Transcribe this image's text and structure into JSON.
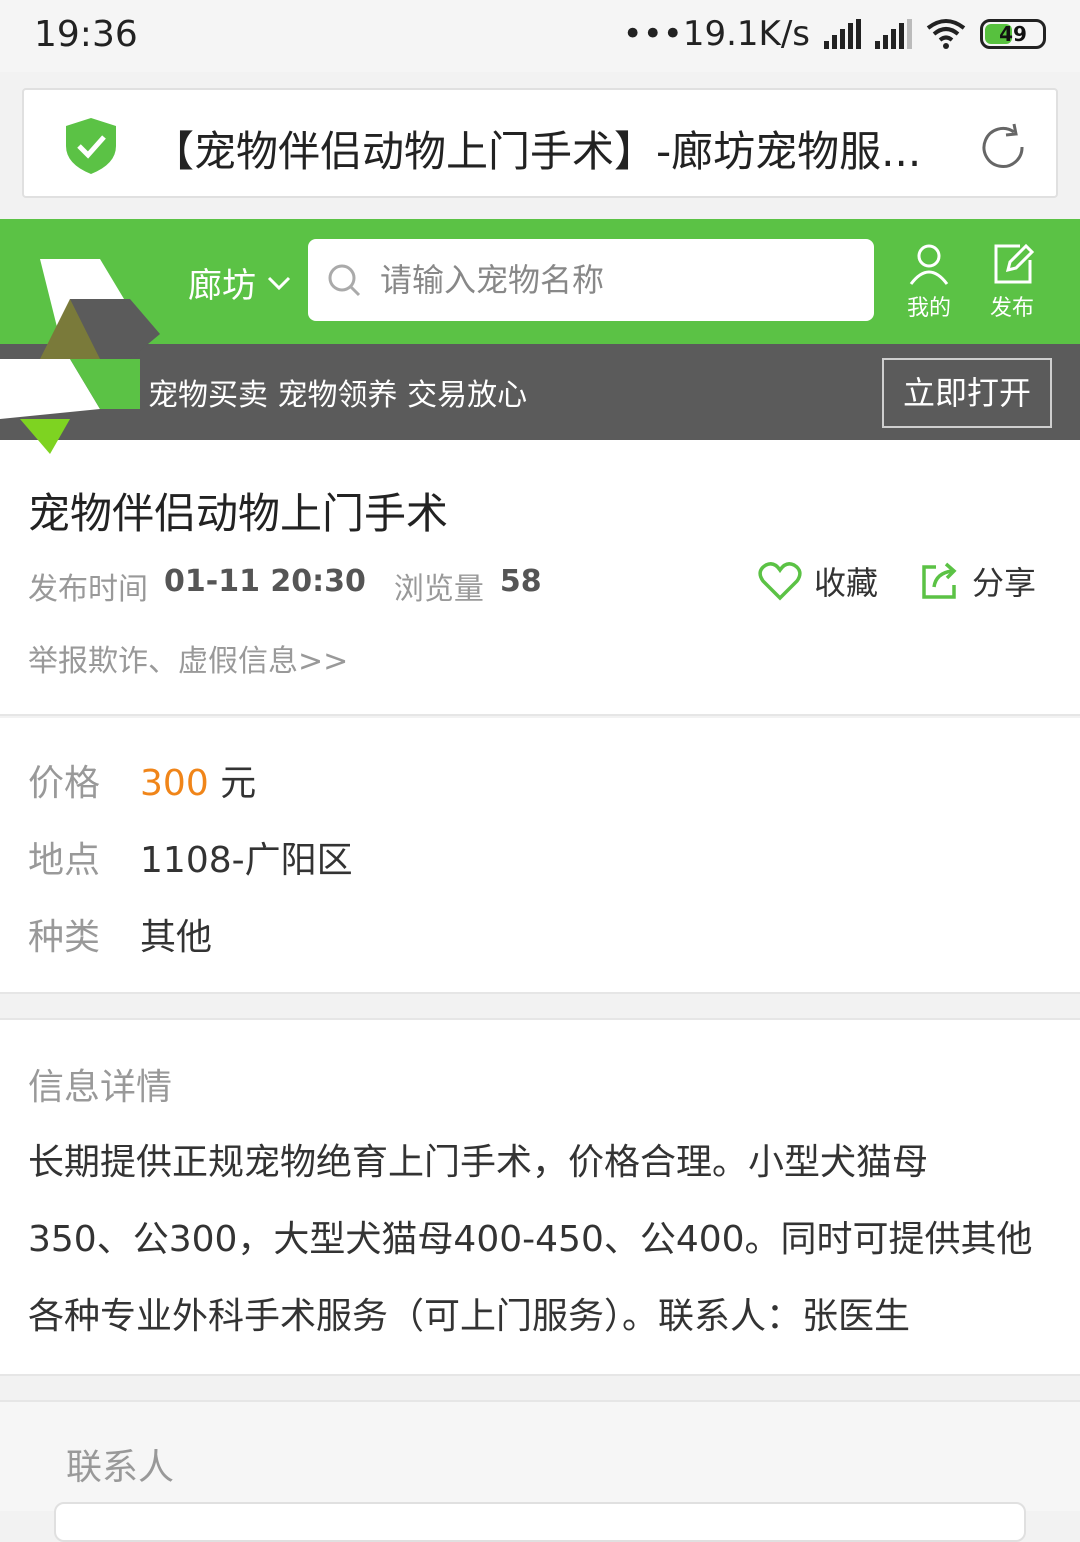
{
  "status_bar": {
    "time": "19:36",
    "network_speed": "•••19.1K/s",
    "battery": "49",
    "battery_level": 0.49
  },
  "browser": {
    "page_title": "【宠物伴侣动物上门手术】-廊坊宠物服...",
    "icons": [
      "shield-check-icon",
      "reload-icon"
    ]
  },
  "header": {
    "city": "廊坊",
    "search_placeholder": "请输入宠物名称",
    "my_label": "我的",
    "publish_label": "发布",
    "accent_color": "#5bc245"
  },
  "promo": {
    "text": "宠物买卖 宠物领养 交易放心",
    "open_label": "立即打开"
  },
  "post": {
    "title": "宠物伴侣动物上门手术",
    "publish_time_label": "发布时间",
    "publish_time": "01-11 20:30",
    "views_label": "浏览量",
    "views": "58",
    "favorite_label": "收藏",
    "share_label": "分享",
    "report_link": "举报欺诈、虚假信息>>"
  },
  "info": {
    "price_label": "价格",
    "price_value": "300",
    "price_unit": "元",
    "location_label": "地点",
    "location_value": "1108-广阳区",
    "category_label": "种类",
    "category_value": "其他",
    "price_color": "#f08519"
  },
  "detail": {
    "heading": "信息详情",
    "line1": "长期提供正规宠物绝育上门手术，价格合理。小型犬猫母",
    "line2": "350、公300，大型犬猫母400-450、公400。同时可提供其他",
    "line3": "各种专业外科手术服务（可上门服务）。联系人：张医生"
  },
  "contact": {
    "heading": "联系人"
  }
}
